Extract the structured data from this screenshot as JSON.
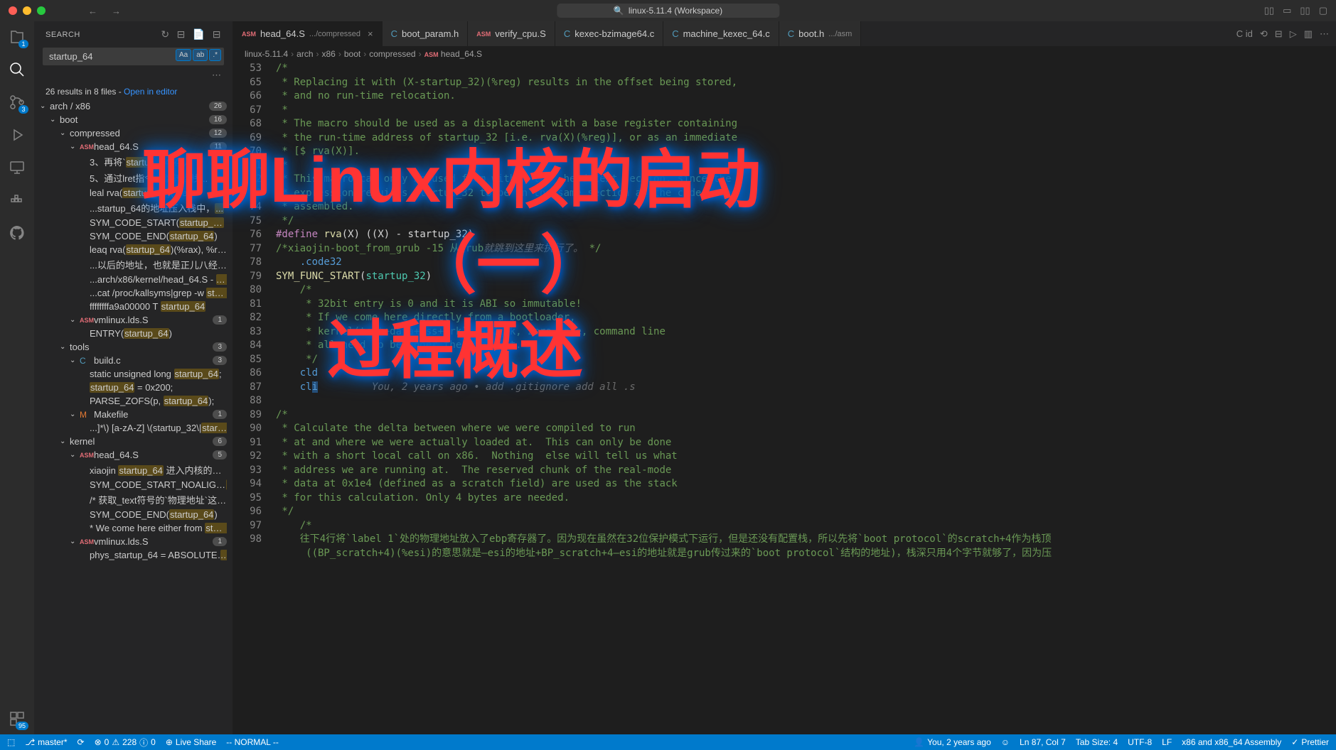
{
  "titlebar": {
    "workspace": "linux-5.11.4 (Workspace)"
  },
  "sidebar": {
    "title": "SEARCH",
    "search_value": "startup_64",
    "results_text": "26 results in 8 files - ",
    "open_in_editor": "Open in editor"
  },
  "tabs": [
    {
      "icon": "asm",
      "label": "head_64.S",
      "path": ".../compressed",
      "active": true,
      "close": true
    },
    {
      "icon": "c",
      "label": "boot_param.h",
      "active": false
    },
    {
      "icon": "asm",
      "label": "verify_cpu.S",
      "active": false
    },
    {
      "icon": "c",
      "label": "kexec-bzimage64.c",
      "active": false
    },
    {
      "icon": "c",
      "label": "machine_kexec_64.c",
      "active": false
    },
    {
      "icon": "c",
      "label": "boot.h",
      "path": ".../asm",
      "active": false
    }
  ],
  "breadcrumb": [
    "linux-5.11.4",
    "arch",
    "x86",
    "boot",
    "compressed",
    "head_64.S"
  ],
  "tree": [
    {
      "depth": 0,
      "chev": "v",
      "label": "arch / x86",
      "badge": "26"
    },
    {
      "depth": 1,
      "chev": "v",
      "label": "boot",
      "badge": "16"
    },
    {
      "depth": 2,
      "chev": "v",
      "label": "compressed",
      "badge": "12"
    },
    {
      "depth": 3,
      "chev": "v",
      "icon": "asm",
      "label": "head_64.S",
      "badge": "11"
    },
    {
      "depth": 4,
      "html": "3、再将`<span class='highlight'>startup_64</span>`存入"
    },
    {
      "depth": 4,
      "html": "5、通过lret指令，跳转到栈..."
    },
    {
      "depth": 4,
      "html": "leal   rva(<span class='highlight'>startup_64</span>)(%e..."
    },
    {
      "depth": 4,
      "html": "...startup_64的地址压入栈中，<span class='highlight'>...</span>"
    },
    {
      "depth": 4,
      "html": "SYM_CODE_START(<span class='highlight'>startup_64</span>) /*xiaoj..."
    },
    {
      "depth": 4,
      "html": "SYM_CODE_END(<span class='highlight'>startup_64</span>)"
    },
    {
      "depth": 4,
      "html": "leaq rva(<span class='highlight'>startup_64</span>)(%rax), %rax"
    },
    {
      "depth": 4,
      "html": "...以后的地址，也就是正儿八经内核代码段..."
    },
    {
      "depth": 4,
      "html": "...arch/x86/kernel/head_64.S - <span class='highlight'>startup_...</span>"
    },
    {
      "depth": 4,
      "html": "...cat /proc/kallsyms|grep -w <span class='highlight'>startup_64</span>"
    },
    {
      "depth": 4,
      "html": "ffffffffa9a00000 T <span class='highlight'>startup_64</span>"
    },
    {
      "depth": 3,
      "chev": "v",
      "icon": "asm",
      "label": "vmlinux.lds.S",
      "badge": "1"
    },
    {
      "depth": 4,
      "html": "ENTRY(<span class='highlight'>startup_64</span>)"
    },
    {
      "depth": 2,
      "chev": "v",
      "label": "tools",
      "badge": "3"
    },
    {
      "depth": 3,
      "chev": "v",
      "icon": "c",
      "label": "build.c",
      "badge": "3"
    },
    {
      "depth": 4,
      "html": "static unsigned long <span class='highlight'>startup_64</span>;"
    },
    {
      "depth": 4,
      "html": "<span class='highlight'>startup_64</span> = 0x200;"
    },
    {
      "depth": 4,
      "html": "PARSE_ZOFS(p, <span class='highlight'>startup_64</span>);"
    },
    {
      "depth": 3,
      "chev": "v",
      "icon": "m",
      "label": "Makefile",
      "badge": "1"
    },
    {
      "depth": 4,
      "html": "...]*\\) [a-zA-Z] \\(startup_32\\|<span class='highlight'>startup_64</span>\\|..."
    },
    {
      "depth": 2,
      "chev": "v",
      "label": "kernel",
      "badge": "6"
    },
    {
      "depth": 3,
      "chev": "v",
      "icon": "asm",
      "label": "head_64.S",
      "badge": "5"
    },
    {
      "depth": 4,
      "html": "xiaojin <span class='highlight'>startup_64</span> 进入内核的第一行代码运..."
    },
    {
      "depth": 4,
      "html": "SYM_CODE_START_NOALIGN(<span class='highlight'>startup_6...</span>"
    },
    {
      "depth": 4,
      "html": "/* 获取_text符号的`物理地址`这个符号跟本..."
    },
    {
      "depth": 4,
      "html": "SYM_CODE_END(<span class='highlight'>startup_64</span>)"
    },
    {
      "depth": 4,
      "html": "* We come here either from <span class='highlight'>startup_64</span> (..."
    },
    {
      "depth": 3,
      "chev": "v",
      "icon": "asm",
      "label": "vmlinux.lds.S",
      "badge": "1"
    },
    {
      "depth": 4,
      "html": "phys_startup_64 = ABSOLUTE(<span class='highlight'>startup</span>..."
    }
  ],
  "code": {
    "lines": [
      {
        "n": 53,
        "t": "<span class='comment'>/*</span>"
      },
      {
        "n": 65,
        "t": "<span class='comment'> * Replacing it with (X-startup_32)(%reg) results in the offset being stored,</span>"
      },
      {
        "n": 66,
        "t": "<span class='comment'> * and no run-time relocation.</span>"
      },
      {
        "n": 67,
        "t": "<span class='comment'> *</span>"
      },
      {
        "n": 68,
        "t": "<span class='comment'> * The macro should be used as a displacement with a base register containing</span>"
      },
      {
        "n": 69,
        "t": "<span class='comment'> * the run-time address of startup_32 [i.e. rva(X)(%reg)], or as an immediate</span>"
      },
      {
        "n": 70,
        "t": "<span class='comment'> * [$ rva(X)].</span>"
      },
      {
        "n": 71,
        "t": "<span class='comment'> *</span>"
      },
      {
        "n": 72,
        "t": "<span class='comment'> * This macro can only be used from within the .head.text section, since the</span>"
      },
      {
        "n": 73,
        "t": "<span class='comment'> * expression requires startup_32 to be in the same section as the code being</span>"
      },
      {
        "n": 74,
        "t": "<span class='comment'> * assembled.</span>"
      },
      {
        "n": 75,
        "t": "<span class='comment'> */</span>"
      },
      {
        "n": 76,
        "t": "<span class='macro'>#define</span> <span class='func'>rva</span>(X) ((X) - startup_32)"
      },
      {
        "n": 77,
        "t": "<span class='comment'>/*xiaojin-boot_from_grub -15 从grub</span><span class='ghosthint'>就跳到这里来执行了。</span><span class='comment'> */</span>"
      },
      {
        "n": 78,
        "t": "    <span class='keyword'>.code32</span>"
      },
      {
        "n": 79,
        "t": "<span class='func'>SYM_FUNC_START</span>(<span class='symbol'>startup_32</span>)"
      },
      {
        "n": 80,
        "t": "    <span class='comment'>/*</span>"
      },
      {
        "n": 81,
        "t": "    <span class='comment'> * 32bit entry is 0 and it is ABI so immutable!</span>"
      },
      {
        "n": 82,
        "t": "    <span class='comment'> * If we come here directly from a bootloader,</span>"
      },
      {
        "n": 83,
        "t": "    <span class='comment'> * kernel(text+data+bss+brk) ramdisk, zero_page, command line</span>"
      },
      {
        "n": 84,
        "t": "    <span class='comment'> * all need to be under the 4G limit.</span>"
      },
      {
        "n": 85,
        "t": "    <span class='comment'> */</span>"
      },
      {
        "n": 86,
        "t": "    <span class='keyword'>cld</span>"
      },
      {
        "n": 87,
        "t": "    <span class='keyword'>cl<span class='cursor-highlight'>i</span></span>         <span class='ghosthint'>You, 2 years ago • add .gitignore add all .s</span>"
      },
      {
        "n": 88,
        "t": ""
      },
      {
        "n": 89,
        "t": "<span class='comment'>/*</span>"
      },
      {
        "n": 90,
        "t": "<span class='comment'> * Calculate the delta between where we were compiled to run</span>"
      },
      {
        "n": 91,
        "t": "<span class='comment'> * at and where we were actually loaded at.  This can only be done</span>"
      },
      {
        "n": 92,
        "t": "<span class='comment'> * with a short local call on x86.  Nothing  else will tell us what</span>"
      },
      {
        "n": 93,
        "t": "<span class='comment'> * address we are running at.  The reserved chunk of the real-mode</span>"
      },
      {
        "n": 94,
        "t": "<span class='comment'> * data at 0x1e4 (defined as a scratch field) are used as the stack</span>"
      },
      {
        "n": 95,
        "t": "<span class='comment'> * for this calculation. Only 4 bytes are needed.</span>"
      },
      {
        "n": 96,
        "t": "<span class='comment'> */</span>"
      },
      {
        "n": 97,
        "t": "    <span class='comment'>/*</span>"
      },
      {
        "n": 98,
        "t": "    <span class='comment'>往下4行将`label 1`处的物理地址放入了ebp寄存器了。因为现在虽然在32位保护模式下运行，但是还没有配置栈，所以先将`boot protocol`的scratch+4作为栈顶\n     ((BP_scratch+4)(%esi)的意思就是—esi的地址+BP_scratch+4—esi的地址就是grub传过来的`boot protocol`结构的地址)，栈深只用4个字节就够了，因为压</span>"
      }
    ]
  },
  "overlay": {
    "line1": "聊聊Linux内核的启动",
    "line2": "（一）",
    "line3": "过程概述"
  },
  "statusbar": {
    "branch": "master*",
    "sync": "",
    "errors": "0",
    "warnings": "228",
    "infos": "0",
    "liveshare": "Live Share",
    "mode": "-- NORMAL --",
    "blame": "You, 2 years ago",
    "pos": "Ln 87, Col 7",
    "tabsize": "Tab Size: 4",
    "encoding": "UTF-8",
    "eol": "LF",
    "lang": "x86 and x86_64 Assembly",
    "prettier": "Prettier"
  },
  "activity_badges": {
    "explorer": "1",
    "scm": "3",
    "ext": "95"
  }
}
